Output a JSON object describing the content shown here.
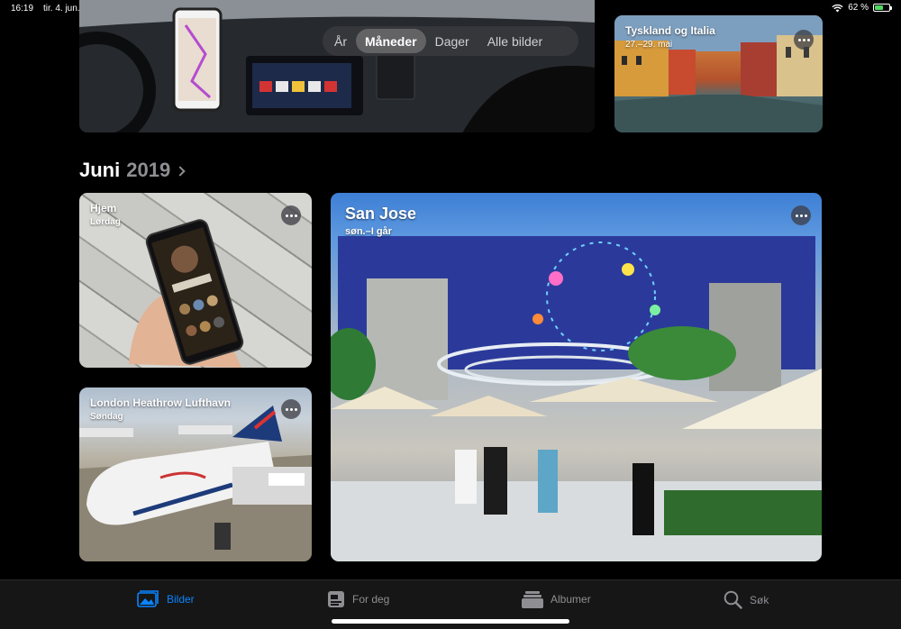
{
  "status": {
    "time": "16:19",
    "date": "tir. 4. jun.",
    "battery": "62 %",
    "battery_fraction": 0.62
  },
  "segments": [
    {
      "label": "År",
      "active": false
    },
    {
      "label": "Måneder",
      "active": true
    },
    {
      "label": "Dager",
      "active": false
    },
    {
      "label": "Alle bilder",
      "active": false
    }
  ],
  "top_cards": {
    "italia": {
      "title": "Tyskland og Italia",
      "sub": "27.–29. mai"
    }
  },
  "section": {
    "month": "Juni",
    "year": "2019"
  },
  "cards": {
    "hjem": {
      "title": "Hjem",
      "sub": "Lørdag"
    },
    "heathrow": {
      "title": "London Heathrow Lufthavn",
      "sub": "Søndag"
    },
    "sanjose": {
      "title": "San Jose",
      "sub": "søn.–I går"
    }
  },
  "tabs": [
    {
      "label": "Bilder",
      "icon": "photos-icon",
      "active": true
    },
    {
      "label": "For deg",
      "icon": "for-you-icon",
      "active": false
    },
    {
      "label": "Albumer",
      "icon": "albums-icon",
      "active": false
    },
    {
      "label": "Søk",
      "icon": "search-icon",
      "active": false
    }
  ],
  "colors": {
    "accent": "#0a84ff",
    "inactive": "#8e8e93",
    "battery": "#4cd964"
  }
}
